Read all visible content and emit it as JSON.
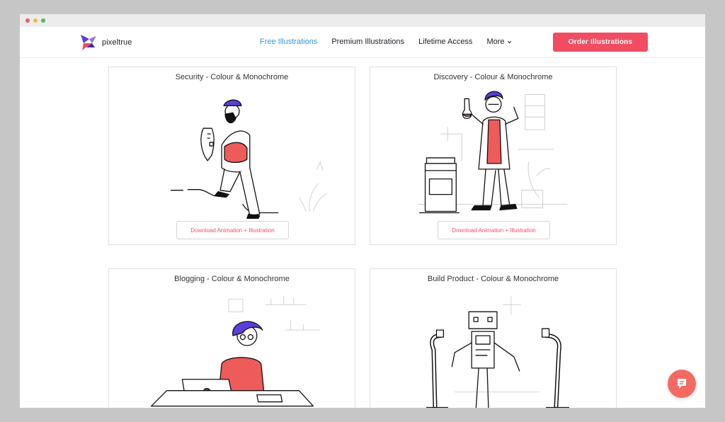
{
  "brand": {
    "name": "pixeltrue"
  },
  "nav": {
    "links": [
      {
        "label": "Free Illustrations",
        "active": true
      },
      {
        "label": "Premium Illustrations"
      },
      {
        "label": "Lifetime Access"
      },
      {
        "label": "More"
      }
    ],
    "cta_label": "Order Illustrations"
  },
  "cards": [
    {
      "title": "Security - Colour & Monochrome",
      "button": "Download Animation + Illustration"
    },
    {
      "title": "Discovery - Colour & Monochrome",
      "button": "Download Animation + Illustration"
    },
    {
      "title": "Blogging - Colour & Monochrome"
    },
    {
      "title": "Build Product - Colour & Monochrome"
    }
  ],
  "colors": {
    "accent": "#f04d63",
    "link_active": "#3694d8",
    "purple": "#5b3fd6",
    "chat": "#f26a62"
  },
  "icons": {
    "chat": "chat-bubble-icon",
    "more": "chevron-down-icon"
  }
}
